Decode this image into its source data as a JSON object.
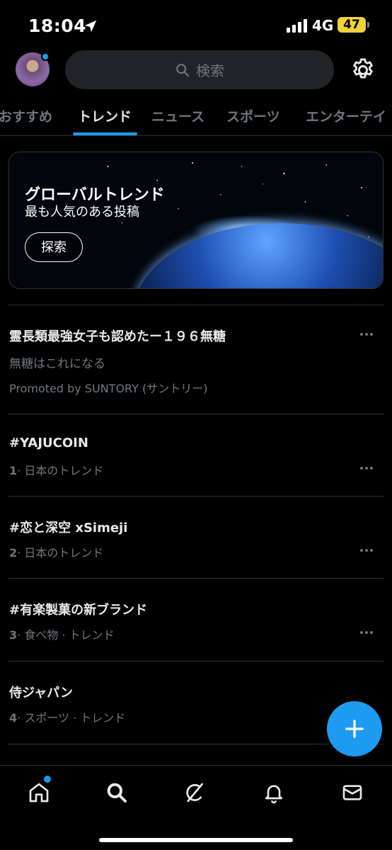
{
  "status_bar": {
    "time": "18:04",
    "network": "4G",
    "battery": "47"
  },
  "header": {
    "search_placeholder": "検索"
  },
  "tabs": [
    {
      "label": "おすすめ"
    },
    {
      "label": "トレンド"
    },
    {
      "label": "ニュース"
    },
    {
      "label": "スポーツ"
    },
    {
      "label": "エンターテイ"
    }
  ],
  "global_card": {
    "title": "グローバルトレンド",
    "subtitle": "最も人気のある投稿",
    "button_label": "探索"
  },
  "promoted": {
    "title": "霊長類最強女子も認めたー１９６無糖",
    "description": "無糖はこれになる",
    "sponsor": "Promoted by SUNTORY (サントリー)"
  },
  "trends": [
    {
      "rank": "1",
      "title": "#YAJUCOIN",
      "category": "· 日本のトレンド"
    },
    {
      "rank": "2",
      "title": "#恋と深空 xSimeji",
      "category": "· 日本のトレンド"
    },
    {
      "rank": "3",
      "title": "#有楽製菓の新ブランド",
      "category": "· 食べ物 · トレンド"
    },
    {
      "rank": "4",
      "title": "侍ジャパン",
      "category": "· スポーツ · トレンド"
    }
  ],
  "colors": {
    "accent": "#1d9bf0",
    "background": "#000000",
    "muted": "#71767b",
    "battery": "#f0d23a"
  },
  "icons": [
    "location-arrow-icon",
    "signal-icon",
    "search-icon",
    "gear-icon",
    "more-icon",
    "plus-icon",
    "home-icon",
    "grok-icon",
    "bell-icon",
    "mail-icon"
  ]
}
